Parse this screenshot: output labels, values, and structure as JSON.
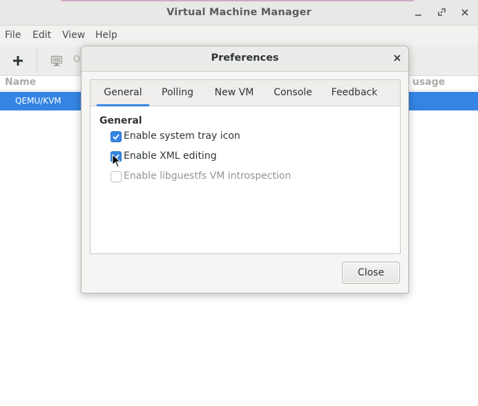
{
  "window": {
    "title": "Virtual Machine Manager"
  },
  "menubar": {
    "items": [
      "File",
      "Edit",
      "View",
      "Help"
    ]
  },
  "toolbar": {
    "open_label": "O"
  },
  "vm_list": {
    "columns": [
      "Name",
      "usage"
    ],
    "rows": [
      {
        "name": "QEMU/KVM",
        "selected": true
      }
    ]
  },
  "dialog": {
    "title": "Preferences",
    "tabs": [
      "General",
      "Polling",
      "New VM",
      "Console",
      "Feedback"
    ],
    "active_tab": "General",
    "section_title": "General",
    "options": [
      {
        "label": "Enable system tray icon",
        "checked": true,
        "enabled": true
      },
      {
        "label": "Enable XML editing",
        "checked": true,
        "enabled": true
      },
      {
        "label": "Enable libguestfs VM introspection",
        "checked": false,
        "enabled": false
      }
    ],
    "close_label": "Close"
  },
  "colors": {
    "accent": "#3584e4",
    "titlebar_bg": "#e8e8e7",
    "dialog_bg": "#f6f5f4"
  },
  "icons": {
    "minimize": "minimize-icon",
    "maximize": "maximize-icon",
    "close": "close-icon",
    "new_vm": "plus-icon",
    "console": "monitor-icon",
    "pointer": "mouse-cursor-icon"
  }
}
